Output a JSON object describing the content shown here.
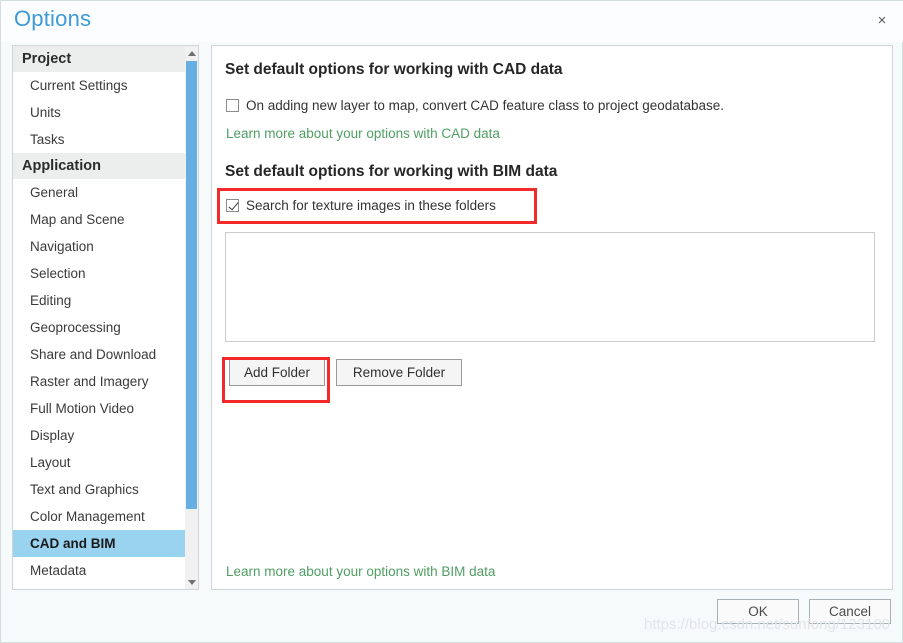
{
  "window": {
    "title": "Options",
    "close_label": "×"
  },
  "sidebar": {
    "groups": [
      {
        "header": "Project",
        "items": [
          {
            "label": "Current Settings",
            "selected": false
          },
          {
            "label": "Units",
            "selected": false
          },
          {
            "label": "Tasks",
            "selected": false
          }
        ]
      },
      {
        "header": "Application",
        "items": [
          {
            "label": "General",
            "selected": false
          },
          {
            "label": "Map and Scene",
            "selected": false
          },
          {
            "label": "Navigation",
            "selected": false
          },
          {
            "label": "Selection",
            "selected": false
          },
          {
            "label": "Editing",
            "selected": false
          },
          {
            "label": "Geoprocessing",
            "selected": false
          },
          {
            "label": "Share and Download",
            "selected": false
          },
          {
            "label": "Raster and Imagery",
            "selected": false
          },
          {
            "label": "Full Motion Video",
            "selected": false
          },
          {
            "label": "Display",
            "selected": false
          },
          {
            "label": "Layout",
            "selected": false
          },
          {
            "label": "Text and Graphics",
            "selected": false
          },
          {
            "label": "Color Management",
            "selected": false
          },
          {
            "label": "CAD and BIM",
            "selected": true
          },
          {
            "label": "Metadata",
            "selected": false
          }
        ]
      }
    ]
  },
  "main": {
    "cad_section_title": "Set default options for working with CAD data",
    "cad_checkbox_label": "On adding new layer to map, convert CAD feature class to project geodatabase.",
    "cad_checkbox_checked": false,
    "cad_help_link": "Learn more about your options with CAD data",
    "bim_section_title": "Set default options for working with BIM data",
    "bim_checkbox_label": "Search for texture images in these folders",
    "bim_checkbox_checked": true,
    "add_folder_label": "Add Folder",
    "remove_folder_label": "Remove Folder",
    "folders": [],
    "bim_help_link": "Learn more about your options with BIM data"
  },
  "footer": {
    "ok_label": "OK",
    "cancel_label": "Cancel"
  },
  "watermark": {
    "text": "https://blog.csdn.net/sunfong/123100"
  },
  "colors": {
    "title_blue": "#3d9ad6",
    "selection_blue": "#9ad3f0",
    "link_green": "#4f9e63",
    "highlight_red": "#f22a2a",
    "scrollbar_blue": "#67afe3"
  }
}
